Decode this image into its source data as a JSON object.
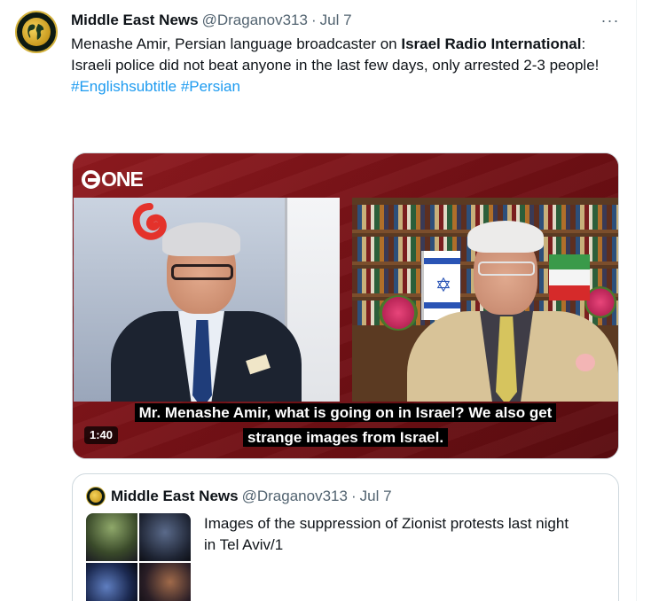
{
  "tweet": {
    "author_name": "Middle East News",
    "handle": "@Draganov313",
    "separator": "·",
    "date": "Jul 7",
    "more_label": "···",
    "text_intro": "Menashe Amir, Persian language broadcaster on ",
    "text_bold": "Israel Radio International",
    "text_colon": ":",
    "text_body": "Israeli police did not beat anyone in the last few days, only arrested 2-3 people!",
    "hashtags": [
      "#Englishsubtitle",
      "#Persian"
    ]
  },
  "video": {
    "channel_logo": "ONE",
    "subtitle_line1": "Mr. Menashe Amir, what is going on in Israel? We also get",
    "subtitle_line2": "strange images from Israel.",
    "duration": "1:40"
  },
  "quoted_tweet": {
    "author_name": "Middle East News",
    "handle": "@Draganov313",
    "separator": "·",
    "date": "Jul 7",
    "text": "Images of the suppression of Zionist protests last night in Tel Aviv/1"
  },
  "icons": {
    "avatar": "globe-avatar-icon",
    "more": "more-options-icon",
    "star": "star-of-david-icon"
  },
  "colors": {
    "link": "#1d9bf0",
    "text_primary": "#0f1419",
    "text_secondary": "#536471",
    "video_background": "#7a1318"
  }
}
